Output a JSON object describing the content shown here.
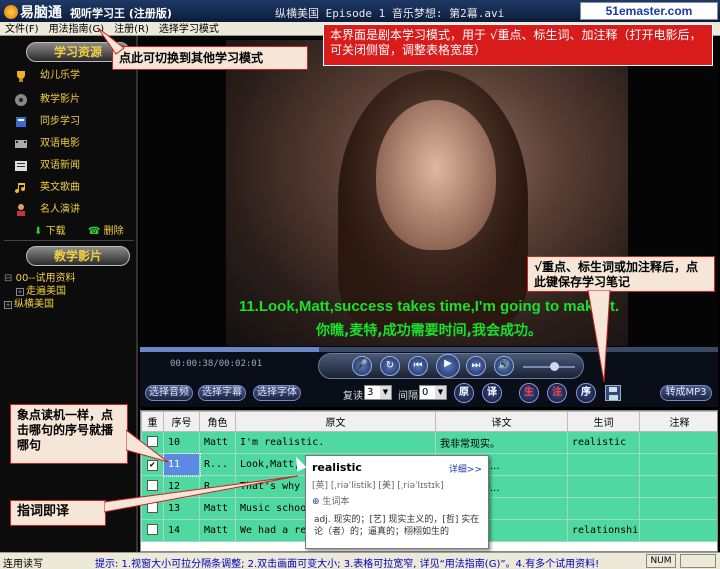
{
  "titlebar": {
    "app_name": "易脑通",
    "app_subtitle": "视听学习王 (注册版)",
    "window_title": "纵横美国 Episode 1 音乐梦想: 第2幕.avi",
    "watermark": "51emaster.com"
  },
  "menu": [
    "文件(F)",
    "用法指南(G)",
    "注册(R)",
    "选择学习模式"
  ],
  "sidebar": {
    "section1_header": "学习资源",
    "items": [
      {
        "label": "幼儿乐学",
        "icon": "trophy-icon"
      },
      {
        "label": "教学影片",
        "icon": "film-reel-icon"
      },
      {
        "label": "同步学习",
        "icon": "book-icon"
      },
      {
        "label": "双语电影",
        "icon": "movie-icon"
      },
      {
        "label": "双语新闻",
        "icon": "news-icon"
      },
      {
        "label": "英文歌曲",
        "icon": "music-note-icon"
      },
      {
        "label": "名人演讲",
        "icon": "speaker-person-icon"
      }
    ],
    "download_label": "下载",
    "delete_label": "删除",
    "section2_header": "教学影片",
    "tree": [
      {
        "label": "00--试用资料"
      },
      {
        "label": "走遍美国"
      },
      {
        "label": "纵横美国"
      }
    ]
  },
  "video": {
    "subtitle_en": "11.Look,Matt,success takes time,I'm going to make it.",
    "subtitle_zh": "你瞧,麦特,成功需要时间,我会成功。"
  },
  "player": {
    "time": "00:00:38/00:02:01",
    "progress": 0.31,
    "volume": 0.6
  },
  "controls": {
    "btn_audio": "选择音频",
    "btn_subtitle": "选择字幕",
    "btn_font": "选择字体",
    "repeat_label": "复读",
    "repeat_value": "3",
    "interval_label": "间隔",
    "interval_value": "0",
    "round_buttons": [
      "原",
      "译",
      "生",
      "注",
      "序"
    ],
    "mp3_button": "转成MP3"
  },
  "table": {
    "headers": [
      "重",
      "序号",
      "角色",
      "原文",
      "译文",
      "生词",
      "注释"
    ],
    "rows": [
      {
        "checked": false,
        "num": "10",
        "role": "Matt",
        "original": "I'm realistic.",
        "translation": "我非常现实。",
        "word": "realistic",
        "note": ""
      },
      {
        "checked": true,
        "num": "11",
        "role": "R...",
        "original": "Look,Matt,",
        "translation": "成功需要时...",
        "word": "",
        "note": ""
      },
      {
        "checked": false,
        "num": "12",
        "role": "R...",
        "original": "That's why I",
        "translation": "音乐学院的...",
        "word": "",
        "note": ""
      },
      {
        "checked": false,
        "num": "13",
        "role": "Matt",
        "original": "Music school",
        "translation": "你去音乐...",
        "word": "",
        "note": ""
      },
      {
        "checked": false,
        "num": "14",
        "role": "Matt",
        "original": "We had a rel",
        "translation": "吗?",
        "word": "relationship",
        "note": ""
      }
    ]
  },
  "popup": {
    "word": "realistic",
    "detail": "详细>>",
    "phonetic": "[英] [ˌriəˈlistik]    [美] [ˌriəˈlɪstɪk]",
    "notebook": "生词本",
    "definition": "adj. 现实的；[艺] 现实主义的，[哲] 实在论（者）的；逼真的；栩栩如生的"
  },
  "statusbar": {
    "left": "连用读写",
    "tip": "提示: 1.视窗大小可拉分隔条调整; 2.双击画面可变大小; 3.表格可拉宽窄, 详见“用法指南(G)”。4.有多个试用资料!",
    "num": "NUM"
  },
  "callouts": {
    "switch_mode": "点此可切换到其他学习模式",
    "script_mode": "本界面是剧本学习模式，用于 √重点、标生词、加注释（打开电影后，可关闭侧窗，调整表格宽度）",
    "save_notes": "√重点、标生词或加注释后，点此键保存学习笔记",
    "repeat_reader": "象点读机一样，点击哪句的序号就播哪句",
    "point_translate": "指词即译"
  },
  "colors": {
    "row_green": "#4fd8a0",
    "subtitle_green": "#19e02a",
    "callout_red": "#d81b1b"
  }
}
